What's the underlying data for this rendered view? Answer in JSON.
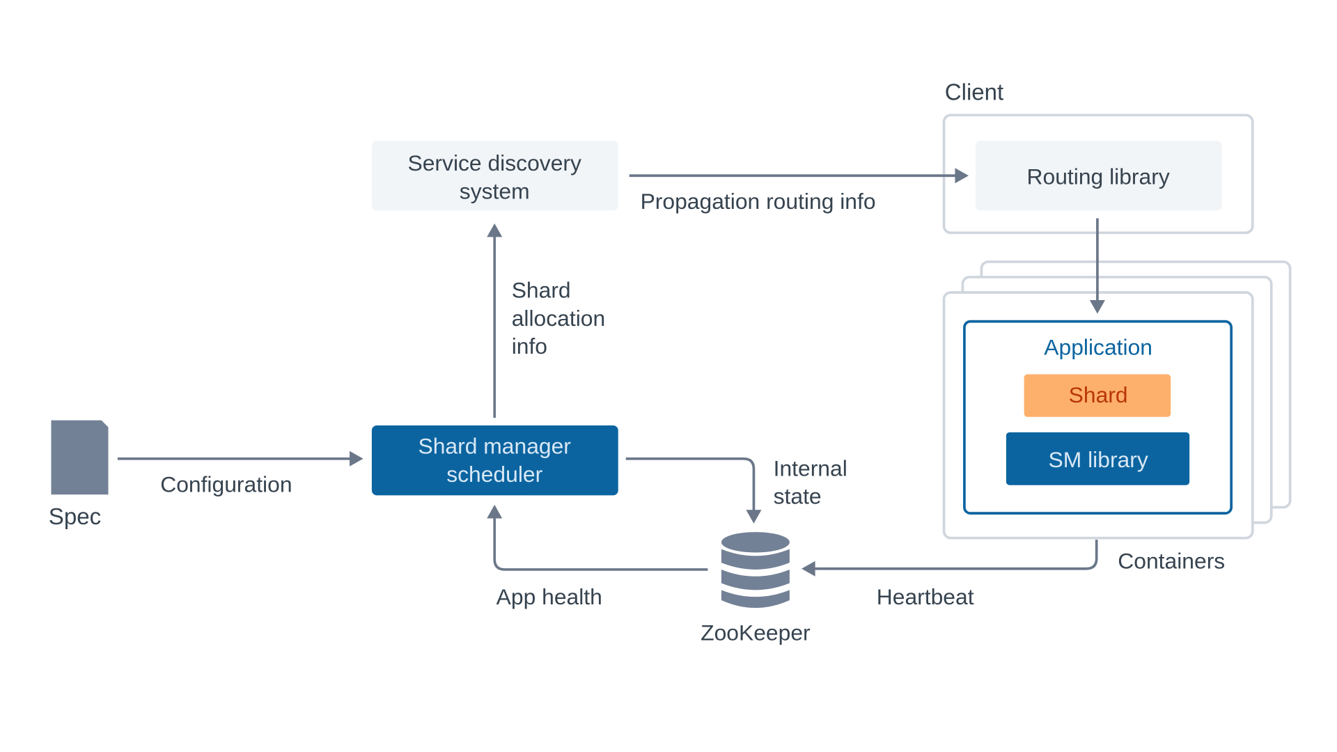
{
  "nodes": {
    "service_discovery": [
      "Service discovery",
      "system"
    ],
    "client": "Client",
    "routing_library": "Routing library",
    "application": "Application",
    "shard": "Shard",
    "sm_library": "SM library",
    "containers": "Containers",
    "shard_manager": [
      "Shard manager",
      "scheduler"
    ],
    "spec": "Spec",
    "zookeeper": "ZooKeeper"
  },
  "edges": {
    "propagation": "Propagation routing info",
    "shard_allocation": [
      "Shard",
      "allocation",
      "info"
    ],
    "configuration": "Configuration",
    "internal_state": [
      "Internal",
      "state"
    ],
    "app_health": "App health",
    "heartbeat": "Heartbeat"
  },
  "colors": {
    "primary_blue": "#0b64a0",
    "shard_orange": "#fdb06b",
    "shard_text": "#b8360a",
    "light_box": "#f2f5f8",
    "border": "#d0d6de",
    "arrow": "#6b7789",
    "text": "#36434f"
  },
  "icons": {
    "spec": "document-icon",
    "zookeeper": "database-icon"
  }
}
